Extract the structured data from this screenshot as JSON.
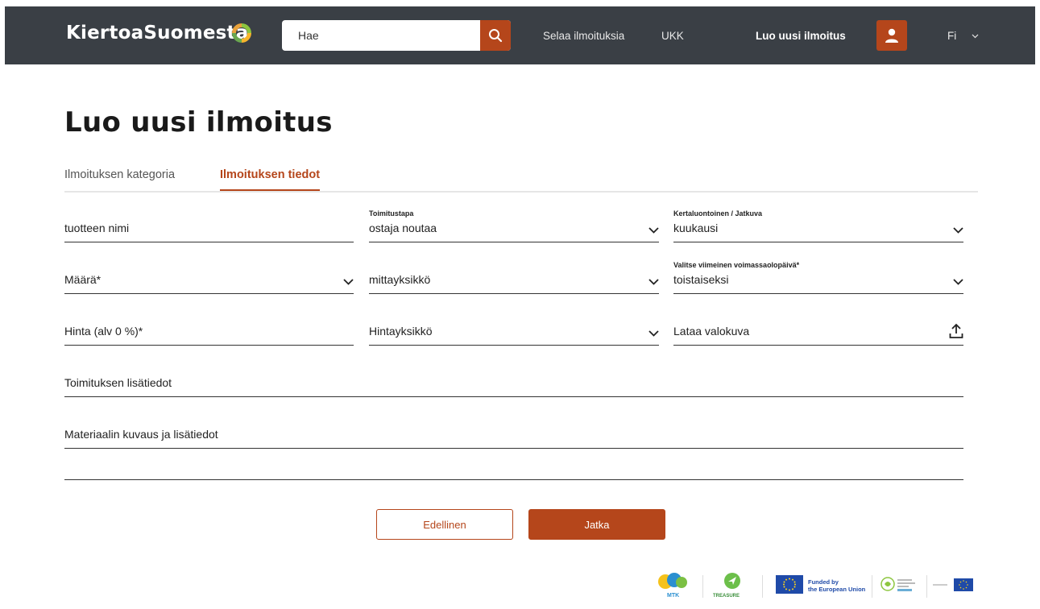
{
  "header": {
    "brand": "KiertoaSuomesta",
    "search_placeholder": "Hae",
    "nav_browse": "Selaa ilmoituksia",
    "nav_faq": "UKK",
    "nav_create": "Luo uusi ilmoitus",
    "language": "Fi"
  },
  "page": {
    "title": "Luo uusi ilmoitus",
    "tabs": [
      {
        "label": "Ilmoituksen kategoria",
        "active": false
      },
      {
        "label": "Ilmoituksen tiedot",
        "active": true
      }
    ]
  },
  "form": {
    "product_name": {
      "label": "",
      "value": "tuotteen nimi"
    },
    "delivery": {
      "label": "Toimitustapa",
      "value": "ostaja noutaa"
    },
    "recurrence": {
      "label": "Kertaluontoinen / Jatkuva",
      "value": "kuukausi"
    },
    "quantity": {
      "label": "",
      "value": "Määrä*"
    },
    "unit": {
      "label": "",
      "value": "mittayksikkö"
    },
    "expiry": {
      "label": "Valitse viimeinen voimassaolopäivä*",
      "value": "toistaiseksi"
    },
    "price": {
      "label": "",
      "value": "Hinta (alv 0 %)*"
    },
    "price_unit": {
      "label": "",
      "value": "Hintayksikkö"
    },
    "photo": {
      "label": "",
      "value": "Lataa valokuva"
    },
    "delivery_info": {
      "label": "",
      "value": "Toimituksen lisätiedot"
    },
    "material_info": {
      "label": "",
      "value": "Materiaalin kuvaus ja lisätiedot"
    }
  },
  "actions": {
    "previous": "Edellinen",
    "continue": "Jatka"
  },
  "footer": {
    "mtk": "MTK",
    "treasure": "TREASURE",
    "eu_line1": "Funded by",
    "eu_line2": "the European Union"
  },
  "colors": {
    "accent": "#b5461b",
    "header_bg": "#3a3f45"
  }
}
